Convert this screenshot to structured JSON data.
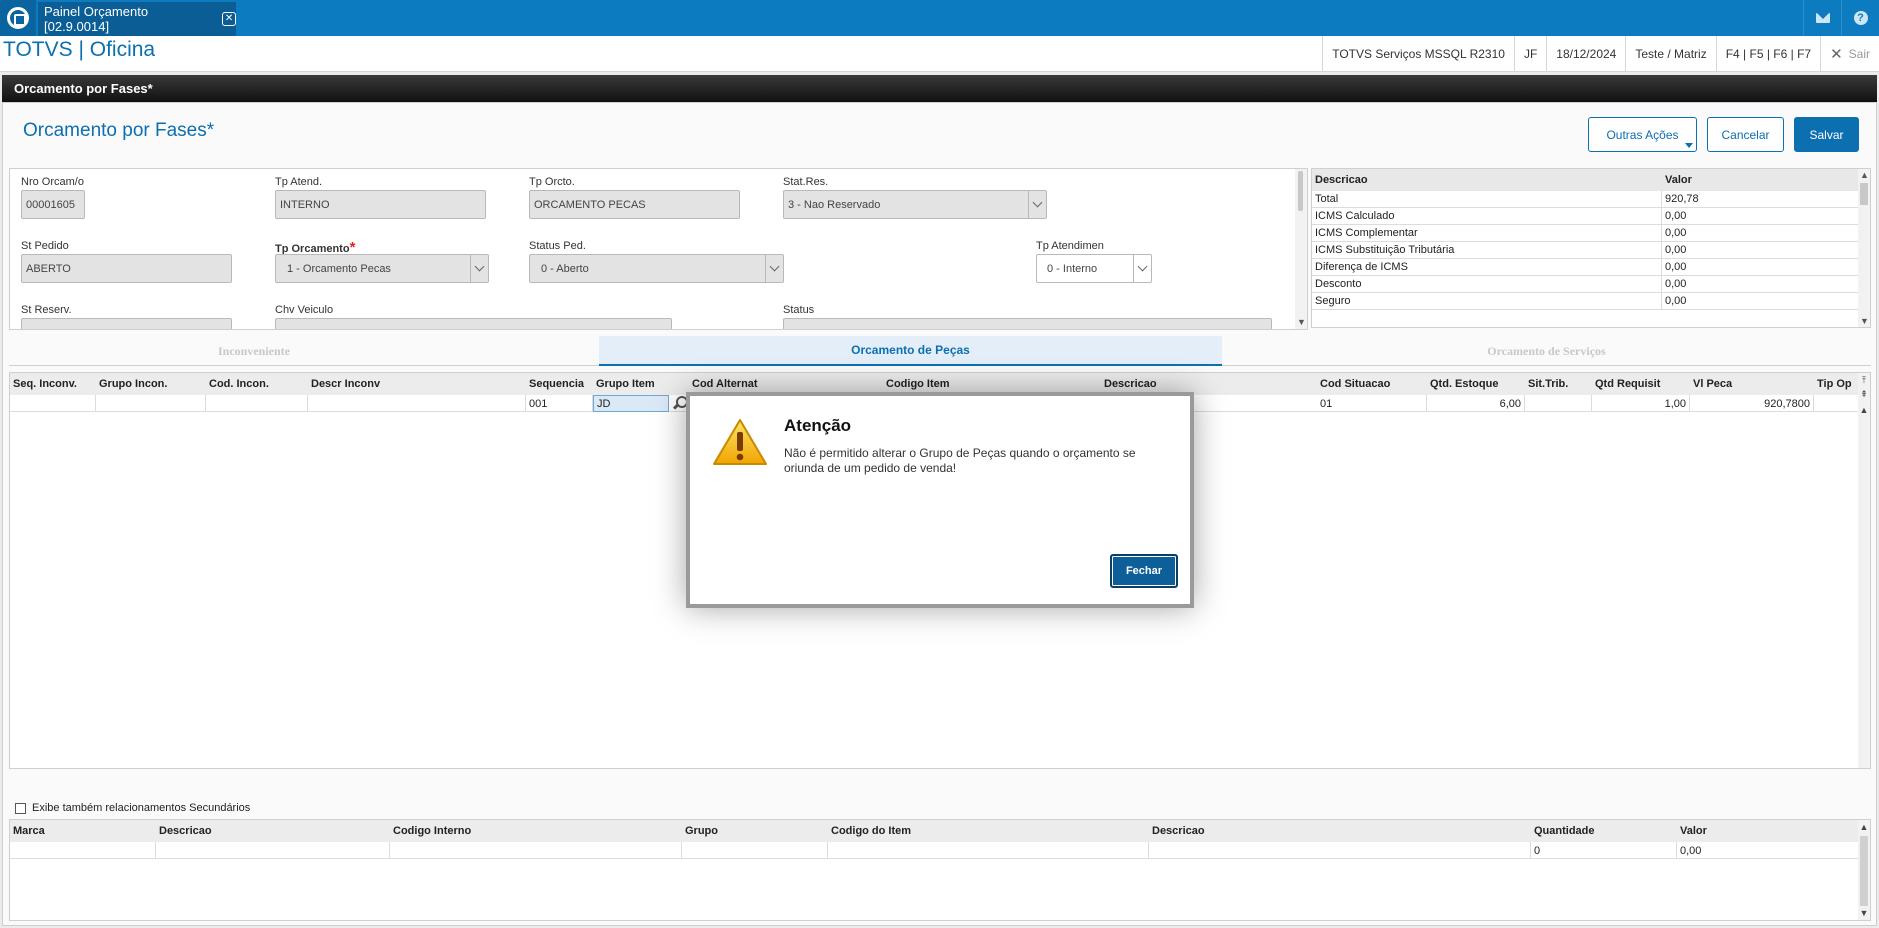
{
  "topbar": {
    "tab_label": "Painel Orçamento [02.9.0014]"
  },
  "header": {
    "app_title": "TOTVS | Oficina",
    "environment": "TOTVS Serviços MSSQL R2310",
    "user": "JF",
    "date": "18/12/2024",
    "branch": "Teste / Matriz",
    "shortcuts": "F4 | F5 | F6 | F7",
    "exit_label": "Sair"
  },
  "section": {
    "title": "Orcamento por Fases*"
  },
  "form": {
    "title": "Orcamento por Fases",
    "title_mark": "*",
    "buttons": {
      "other_actions": "Outras Ações",
      "cancel": "Cancelar",
      "save": "Salvar"
    },
    "fields": {
      "nro_orcamento": {
        "label": "Nro Orcam/o",
        "value": "00001605"
      },
      "tp_atend": {
        "label": "Tp Atend.",
        "value": "INTERNO"
      },
      "tp_orcto": {
        "label": "Tp Orcto.",
        "value": "ORCAMENTO PECAS"
      },
      "stat_res": {
        "label": "Stat.Res.",
        "value": "3 - Nao Reservado"
      },
      "st_pedido": {
        "label": "St Pedido",
        "value": "ABERTO"
      },
      "tp_orcamento": {
        "label": "Tp Orcamento",
        "required_mark": "*",
        "value": "1 - Orcamento Pecas"
      },
      "status_ped": {
        "label": "Status Ped.",
        "value": "0 - Aberto"
      },
      "tp_atendimen": {
        "label": "Tp Atendimen",
        "value": "0 - Interno"
      },
      "st_reserv": {
        "label": "St Reserv."
      },
      "chv_veiculo": {
        "label": "Chv Veiculo"
      },
      "status": {
        "label": "Status"
      }
    }
  },
  "summary": {
    "headers": [
      "Descricao",
      "Valor"
    ],
    "rows": [
      [
        "Total",
        "920,78"
      ],
      [
        "ICMS Calculado",
        "0,00"
      ],
      [
        "ICMS Complementar",
        "0,00"
      ],
      [
        "ICMS Substituição Tributária",
        "0,00"
      ],
      [
        "Diferença de ICMS",
        "0,00"
      ],
      [
        "Desconto",
        "0,00"
      ],
      [
        "Seguro",
        "0,00"
      ]
    ]
  },
  "folders": [
    "Inconveniente",
    "Orcamento de Peças",
    "Orcamento de Serviços"
  ],
  "main_grid": {
    "headers": [
      "Seq. Inconv.",
      "Grupo Incon.",
      "Cod. Incon.",
      "Descr Inconv",
      "Sequencia",
      "Grupo Item",
      "Cod Alternat",
      "Codigo Item",
      "Descricao",
      "Cod Situacao",
      "Qtd. Estoque",
      "Sit.Trib.",
      "Qtd Requisit",
      "Vl Peca",
      "Tip Op"
    ],
    "row": {
      "sequencia": "001",
      "grupo_item": "JD",
      "cod_situacao": "01",
      "qtd_estoque": "6,00",
      "qtd_requisit": "1,00",
      "vl_peca": "920,7800"
    }
  },
  "checkbox": {
    "label": "Exibe também relacionamentos Secundários"
  },
  "bottom_grid": {
    "headers": [
      "Marca",
      "Descricao",
      "Codigo Interno",
      "Grupo",
      "Codigo do Item",
      "Descricao",
      "Quantidade",
      "Valor"
    ],
    "row": {
      "quantidade": "0",
      "valor": "0,00"
    }
  },
  "modal": {
    "title": "Atenção",
    "message": "Não é permitido alterar o Grupo de Peças quando o orçamento se oriunda de um pedido de venda!",
    "close_label": "Fechar"
  }
}
